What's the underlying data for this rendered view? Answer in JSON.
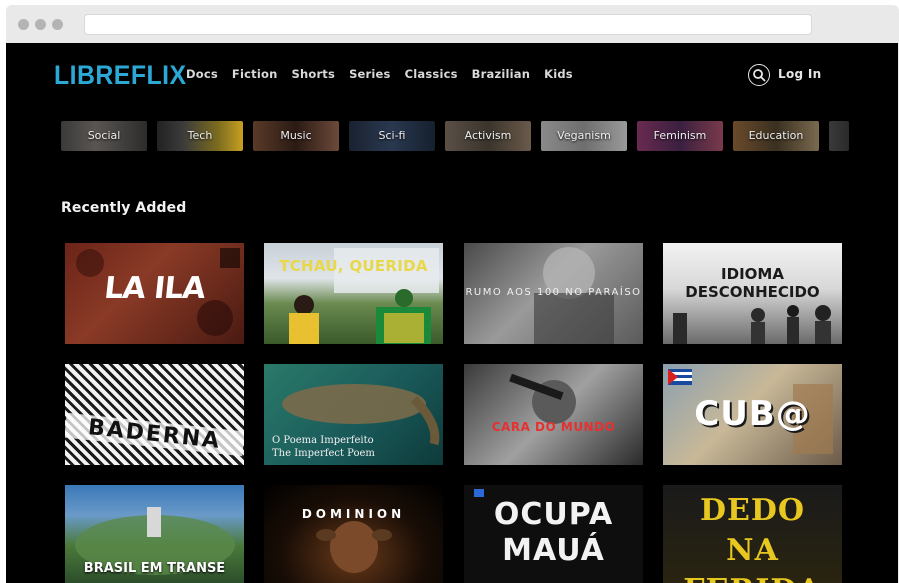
{
  "header": {
    "logo": "LIBREFLIX",
    "nav": [
      "Docs",
      "Fiction",
      "Shorts",
      "Series",
      "Classics",
      "Brazilian",
      "Kids"
    ],
    "login": "Log In",
    "search_icon": "search-icon"
  },
  "categories": [
    "Social",
    "Tech",
    "Music",
    "Sci-fi",
    "Activism",
    "Veganism",
    "Feminism",
    "Education"
  ],
  "section_title": "Recently Added",
  "posters": [
    {
      "title": "LA ILA"
    },
    {
      "title": "TCHAU, QUERIDA"
    },
    {
      "title": "RUMO AOS 100 NO PARAÍSO"
    },
    {
      "title": "IDIOMA DESCONHECIDO"
    },
    {
      "title": "BADERNA"
    },
    {
      "title": "O Poema Imperfeito",
      "subtitle": "The Imperfect Poem"
    },
    {
      "title": "CARA DO MUNDO"
    },
    {
      "title": "CUB@"
    },
    {
      "title": "BRASIL EM TRANSE"
    },
    {
      "title": "DOMINION"
    },
    {
      "title": "OCUPA MAUÁ"
    },
    {
      "title": "DEDO NA FERIDA"
    }
  ],
  "colors": {
    "brand": "#2ba8d6",
    "background": "#000000",
    "nav_text": "#d9d9d9"
  }
}
